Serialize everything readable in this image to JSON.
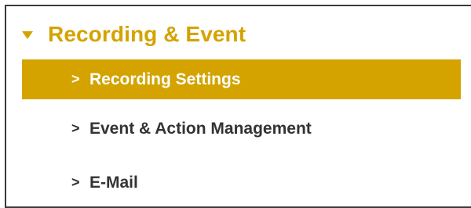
{
  "section": {
    "title": "Recording & Event",
    "icon": "triangle-down-icon",
    "accent_color": "#d4a300"
  },
  "menu": {
    "items": [
      {
        "label": "Recording Settings",
        "active": true,
        "icon": "chevron-right-icon",
        "chevron": ">"
      },
      {
        "label": "Event & Action Management",
        "active": false,
        "icon": "chevron-right-icon",
        "chevron": ">"
      },
      {
        "label": "E-Mail",
        "active": false,
        "icon": "chevron-right-icon",
        "chevron": ">"
      }
    ]
  }
}
